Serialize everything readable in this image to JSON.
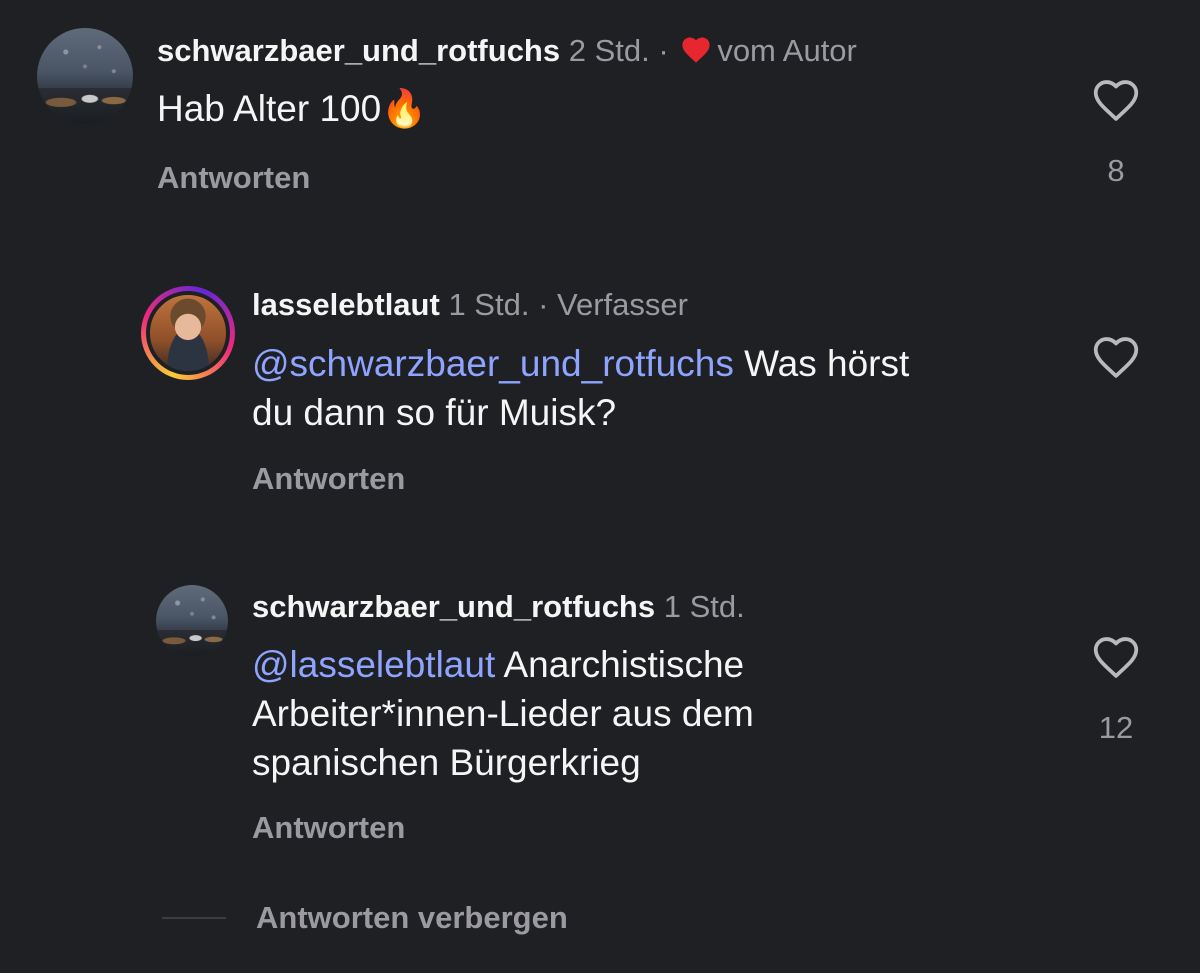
{
  "comments": [
    {
      "username": "schwarzbaer_und_rotfuchs",
      "time": "2 Std.",
      "separator": "·",
      "badge": "vom Autor",
      "badge_icon": "heart-filled-icon",
      "text": "Hab Alter 100",
      "emoji": "🔥",
      "reply_label": "Antworten",
      "like_count": "8"
    },
    {
      "username": "lasselebtlaut",
      "time": "1 Std.",
      "separator": "·",
      "badge": "Verfasser",
      "mention": "@schwarzbaer_und_rotfuchs",
      "text_line1": "Was hörst",
      "text_line2": "du dann so für Muisk?",
      "reply_label": "Antworten",
      "like_count": ""
    },
    {
      "username": "schwarzbaer_und_rotfuchs",
      "time": "1 Std.",
      "mention": "@lasselebtlaut",
      "text_line1": "Anarchistische",
      "text_line2": "Arbeiter*innen-Lieder aus dem",
      "text_line3": "spanischen Bürgerkrieg",
      "reply_label": "Antworten",
      "like_count": "12"
    }
  ],
  "hide_replies_label": "Antworten verbergen",
  "colors": {
    "background": "#1f2024",
    "text": "#f5f5f5",
    "muted": "#9a9aa0",
    "mention": "#8fa4ff",
    "heart_red": "#e8262f"
  }
}
